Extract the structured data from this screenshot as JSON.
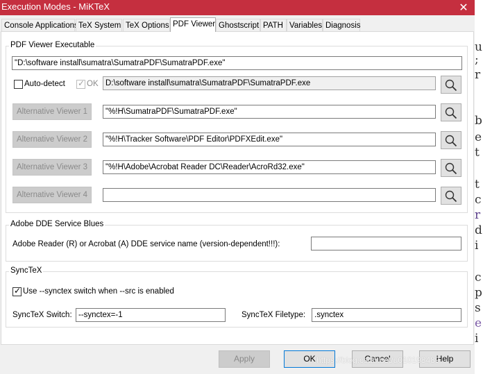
{
  "window": {
    "title": "Execution Modes - MiKTeX",
    "close_glyph": "✕"
  },
  "tabs": [
    {
      "label": "Console Applications"
    },
    {
      "label": "TeX System"
    },
    {
      "label": "TeX Options"
    },
    {
      "label": "PDF Viewer",
      "active": true
    },
    {
      "label": "Ghostscript"
    },
    {
      "label": "PATH"
    },
    {
      "label": "Variables"
    },
    {
      "label": "Diagnosis"
    }
  ],
  "pdf_viewer": {
    "group_title": "PDF Viewer Executable",
    "executable_value": "\"D:\\software install\\sumatra\\SumatraPDF\\SumatraPDF.exe\"",
    "auto_detect_label": "Auto-detect",
    "ok_label": "OK",
    "ok_glyph": "✓",
    "detected_path": "D:\\software install\\sumatra\\SumatraPDF\\SumatraPDF.exe",
    "alternatives": [
      {
        "label": "Alternative Viewer 1",
        "value": "\"%!H\\SumatraPDF\\SumatraPDF.exe\""
      },
      {
        "label": "Alternative Viewer 2",
        "value": "\"%!H\\Tracker Software\\PDF Editor\\PDFXEdit.exe\""
      },
      {
        "label": "Alternative Viewer 3",
        "value": "\"%!H\\Adobe\\Acrobat Reader DC\\Reader\\AcroRd32.exe\""
      },
      {
        "label": "Alternative Viewer 4",
        "value": ""
      }
    ]
  },
  "dde": {
    "group_title": "Adobe DDE Service Blues",
    "service_label": "Adobe Reader (R) or Acrobat (A) DDE service name  (version-dependent!!!):",
    "service_value": ""
  },
  "synctex": {
    "group_title": "SyncTeX",
    "use_label": "Use --synctex switch when --src is enabled",
    "use_checked_glyph": "✓",
    "switch_label": "SyncTeX Switch:",
    "switch_value": "--synctex=-1",
    "filetype_label": "SyncTeX Filetype:",
    "filetype_value": ".synctex"
  },
  "footer": {
    "apply": "Apply",
    "ok": "OK",
    "cancel": "Cancel",
    "help": "Help",
    "watermark": "https://blog.csdn.net/u010198489"
  },
  "background_text": [
    "u",
    ";",
    "r",
    "b",
    "e",
    "t",
    "t",
    "c",
    "r",
    "d",
    "i",
    "c",
    "p",
    "s",
    "e",
    "i"
  ],
  "colors": {
    "titlebar": "#c52f3f",
    "panel": "#ffffff",
    "chrome": "#f0f0f0"
  }
}
